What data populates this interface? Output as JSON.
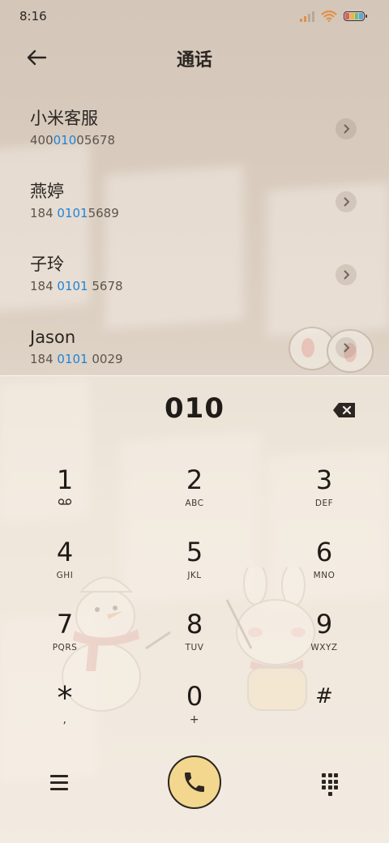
{
  "status_bar": {
    "time": "8:16",
    "battery_colors": [
      "#e25d5d",
      "#e9b44a",
      "#6cc26a",
      "#5aa6e0"
    ]
  },
  "header": {
    "title": "通话",
    "back_icon": "arrow-left-icon"
  },
  "contacts": [
    {
      "name": "小米客服",
      "number_pre": "400",
      "number_hl": "010",
      "number_post": "05678"
    },
    {
      "name": "燕婷",
      "number_pre": "184 ",
      "number_hl": "0101",
      "number_post": "5689"
    },
    {
      "name": "子玲",
      "number_pre": "184 ",
      "number_hl": "0101",
      "number_post": " 5678"
    },
    {
      "name": "Jason",
      "number_pre": "184 ",
      "number_hl": "0101",
      "number_post": " 0029"
    }
  ],
  "dialer": {
    "input": "010",
    "delete_icon": "backspace-icon",
    "keys": [
      {
        "digit": "1",
        "sub": "voicemail-icon"
      },
      {
        "digit": "2",
        "sub": "ABC"
      },
      {
        "digit": "3",
        "sub": "DEF"
      },
      {
        "digit": "4",
        "sub": "GHI"
      },
      {
        "digit": "5",
        "sub": "JKL"
      },
      {
        "digit": "6",
        "sub": "MNO"
      },
      {
        "digit": "7",
        "sub": "PQRS"
      },
      {
        "digit": "8",
        "sub": "TUV"
      },
      {
        "digit": "9",
        "sub": "WXYZ"
      },
      {
        "digit": "*",
        "sub": ","
      },
      {
        "digit": "0",
        "sub": "+"
      },
      {
        "digit": "#",
        "sub": ""
      }
    ]
  },
  "bottom_bar": {
    "menu_icon": "menu-icon",
    "call_icon": "phone-icon",
    "keypad_icon": "dialpad-icon",
    "call_color": "#f4d78e"
  },
  "colors": {
    "highlight": "#1f84d6",
    "background": "#d9cdc1"
  }
}
